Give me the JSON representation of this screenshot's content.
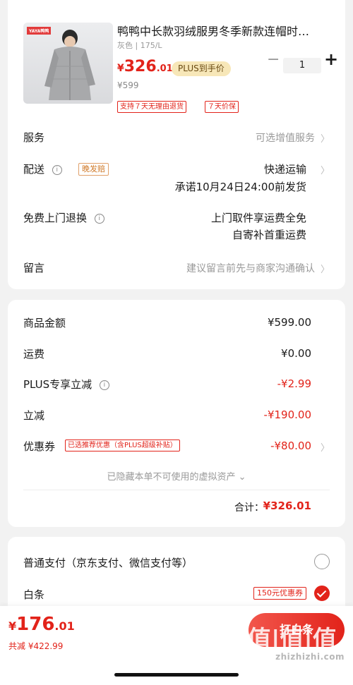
{
  "product": {
    "title": "鸭鸭中长款羽绒服男冬季新款连帽时…",
    "spec": "灰色 | 175/L",
    "price_currency": "¥",
    "price_int": "326",
    "price_dec": ".01",
    "plus_tag": "PLUS到手价",
    "orig_price": "¥599",
    "quantity": "1",
    "minus": "−",
    "plus": "+",
    "tag_return": "支持７天无理由退货",
    "tag_price": "７天价保",
    "image_logo": "YAYA鸭鸭"
  },
  "service": {
    "label": "服务",
    "value": "可选增值服务"
  },
  "delivery": {
    "label": "配送",
    "tag": "晚发赔",
    "method": "快递运输",
    "promise": "承诺10月24日24:00前发货"
  },
  "return_service": {
    "label": "免费上门退换",
    "line1": "上门取件享运费全免",
    "line2": "自寄补首重运费"
  },
  "message": {
    "label": "留言",
    "placeholder": "建议留言前先与商家沟通确认"
  },
  "amounts": {
    "goods_label": "商品金额",
    "goods_value": "¥599.00",
    "shipping_label": "运费",
    "shipping_value": "¥0.00",
    "plus_label": "PLUS专享立减",
    "plus_value": "-¥2.99",
    "discount_label": "立减",
    "discount_value": "-¥190.00",
    "coupon_label": "优惠券",
    "coupon_tag": "已选推荐优惠（含PLUS超级补贴）",
    "coupon_value": "-¥80.00",
    "hidden_assets": "已隐藏本单不可使用的虚拟资产 ⌄",
    "total_label": "合计：",
    "total_value": "¥326.01"
  },
  "payment": {
    "normal_label": "普通支付（京东支付、微信支付等）",
    "baitiao_label": "白条",
    "baitiao_coupon": "150元优惠券"
  },
  "bottom": {
    "currency": "¥",
    "price_int": "176",
    "price_dec": ".01",
    "saved": "共减 ¥422.99",
    "button": "打白条",
    "watermark": "zhizhizhi.com",
    "watermark_logo": "值|值|值"
  },
  "icons": {
    "info": "i",
    "chevron": "〉"
  },
  "colors": {
    "accent": "#e2231a",
    "plus_gold": "#f7e7b8"
  }
}
